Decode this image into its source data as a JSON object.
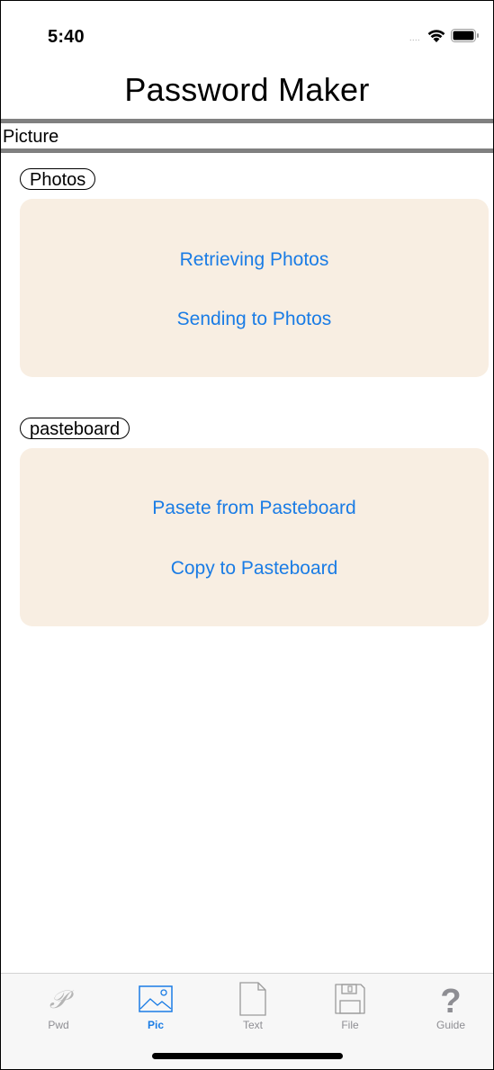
{
  "status_bar": {
    "time": "5:40",
    "signal_dots": "....",
    "wifi_icon": "wifi-icon",
    "battery_icon": "battery-icon"
  },
  "nav": {
    "title": "Password Maker"
  },
  "section": {
    "title": "Picture"
  },
  "groups": [
    {
      "label": "Photos",
      "buttons": [
        "Retrieving Photos",
        "Sending to Photos"
      ]
    },
    {
      "label": "pasteboard",
      "buttons": [
        "Pasete from Pasteboard",
        "Copy to Pasteboard"
      ]
    }
  ],
  "tab_bar": {
    "selected": "Pic",
    "tabs": [
      {
        "label": "Pwd",
        "icon": "script-p-icon"
      },
      {
        "label": "Pic",
        "icon": "picture-icon"
      },
      {
        "label": "Text",
        "icon": "document-icon"
      },
      {
        "label": "File",
        "icon": "floppy-disk-icon"
      },
      {
        "label": "Guide",
        "icon": "question-mark-icon"
      }
    ]
  },
  "colors": {
    "accent": "#1a7ce5",
    "card_background": "#f8eee2",
    "section_rule": "#808080",
    "inactive_tab": "#8e8e93"
  }
}
